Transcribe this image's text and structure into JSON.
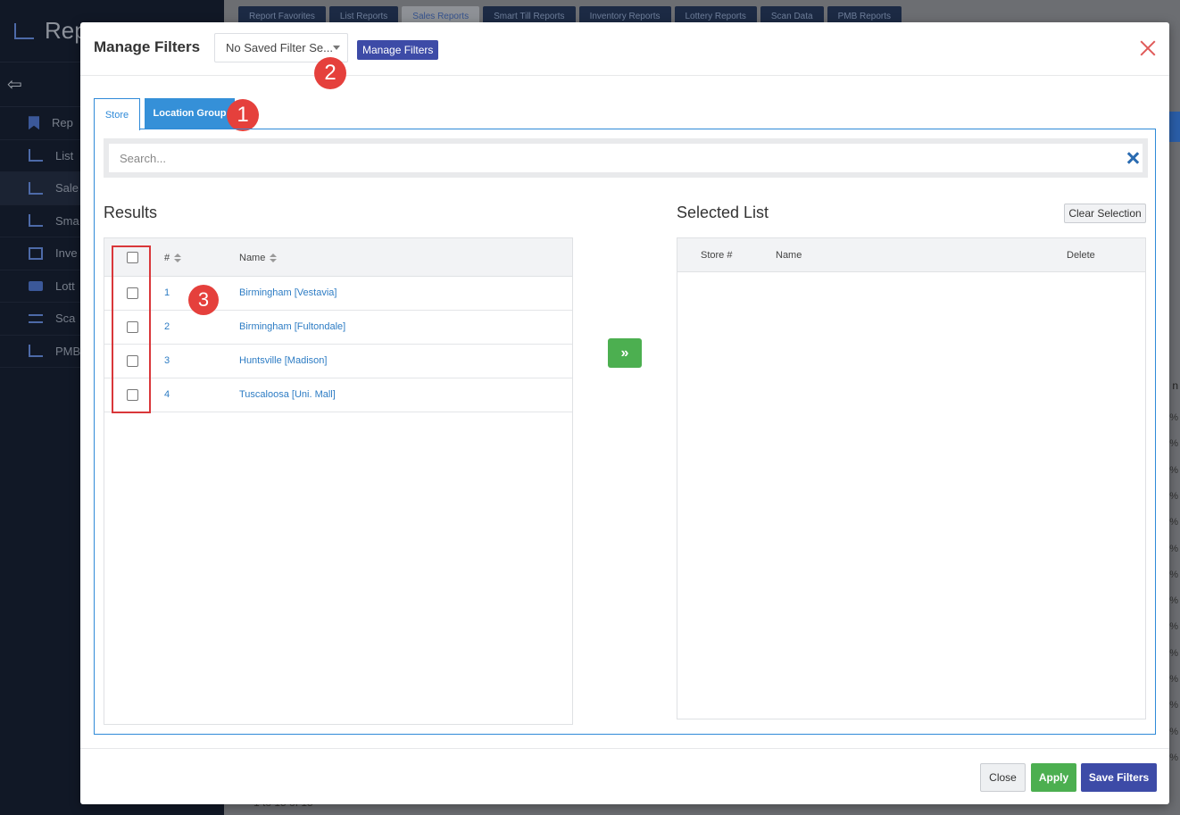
{
  "background": {
    "brand": "Rep",
    "nav_items": [
      "Rep",
      "List",
      "Sale",
      "Sma",
      "Inve",
      "Lott",
      "Sca",
      "PMB"
    ],
    "tabs": [
      "Report Favorites",
      "List Reports",
      "Sales Reports",
      "Smart Till Reports",
      "Inventory Reports",
      "Lottery Reports",
      "Scan Data",
      "PMB Reports"
    ],
    "column_head": "n",
    "pct": "%",
    "footer_text": "1 to 15 of 15"
  },
  "modal": {
    "title": "Manage Filters",
    "saved_filter_value": "No Saved Filter Se...",
    "manage_filters_label": "Manage Filters",
    "tabs": {
      "store": "Store",
      "location_group": "Location Group"
    },
    "search_placeholder": "Search...",
    "results": {
      "title": "Results",
      "columns": {
        "num": "#",
        "name": "Name"
      },
      "rows": [
        {
          "num": "1",
          "name": "Birmingham [Vestavia]"
        },
        {
          "num": "2",
          "name": "Birmingham [Fultondale]"
        },
        {
          "num": "3",
          "name": "Huntsville [Madison]"
        },
        {
          "num": "4",
          "name": "Tuscaloosa [Uni. Mall]"
        }
      ]
    },
    "move_label": "»",
    "selected": {
      "title": "Selected List",
      "clear_label": "Clear Selection",
      "columns": {
        "store": "Store #",
        "name": "Name",
        "delete": "Delete"
      }
    },
    "footer": {
      "close": "Close",
      "apply": "Apply",
      "save": "Save Filters"
    },
    "badges": [
      "1",
      "2",
      "3"
    ]
  },
  "colors": {
    "primary": "#3d4ba7",
    "tab_active": "#3590d8",
    "success": "#4caf50",
    "danger": "#e5403c",
    "link": "#2d7cc4"
  }
}
